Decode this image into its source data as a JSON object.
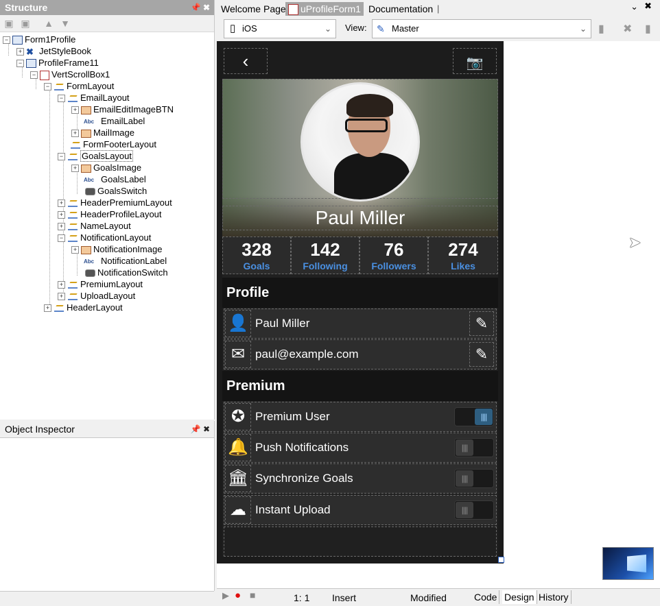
{
  "structure": {
    "title": "Structure",
    "tree": [
      {
        "label": "Form1Profile",
        "icon": "form-icon"
      },
      {
        "label": "JetStyleBook",
        "icon": "stylebook-icon"
      },
      {
        "label": "ProfileFrame11",
        "icon": "frame-icon"
      },
      {
        "label": "VertScrollBox1",
        "icon": "scrollbox-icon"
      },
      {
        "label": "FormLayout",
        "icon": "layout-icon"
      },
      {
        "label": "EmailLayout",
        "icon": "layout-icon"
      },
      {
        "label": "EmailEditImageBTN",
        "icon": "image-icon"
      },
      {
        "label": "EmailLabel",
        "icon": "label-icon"
      },
      {
        "label": "MailImage",
        "icon": "image-icon"
      },
      {
        "label": "FormFooterLayout",
        "icon": "layout-icon"
      },
      {
        "label": "GoalsLayout",
        "icon": "layout-icon"
      },
      {
        "label": "GoalsImage",
        "icon": "image-icon"
      },
      {
        "label": "GoalsLabel",
        "icon": "label-icon"
      },
      {
        "label": "GoalsSwitch",
        "icon": "switch-icon"
      },
      {
        "label": "HeaderPremiumLayout",
        "icon": "layout-icon"
      },
      {
        "label": "HeaderProfileLayout",
        "icon": "layout-icon"
      },
      {
        "label": "NameLayout",
        "icon": "layout-icon"
      },
      {
        "label": "NotificationLayout",
        "icon": "layout-icon"
      },
      {
        "label": "NotificationImage",
        "icon": "image-icon"
      },
      {
        "label": "NotificationLabel",
        "icon": "label-icon"
      },
      {
        "label": "NotificationSwitch",
        "icon": "switch-icon"
      },
      {
        "label": "PremiumLayout",
        "icon": "layout-icon"
      },
      {
        "label": "UploadLayout",
        "icon": "layout-icon"
      },
      {
        "label": "HeaderLayout",
        "icon": "layout-icon"
      }
    ],
    "label_icon_text": "Abc"
  },
  "object_inspector": {
    "title": "Object Inspector"
  },
  "editor_tabs": [
    "Welcome Page",
    "uProfileForm1",
    "Documentation"
  ],
  "designer": {
    "platform": "iOS",
    "view_label": "View:",
    "view_value": "Master"
  },
  "profile": {
    "name": "Paul Miller",
    "stats": [
      {
        "value": "328",
        "label": "Goals"
      },
      {
        "value": "142",
        "label": "Following"
      },
      {
        "value": "76",
        "label": "Followers"
      },
      {
        "value": "274",
        "label": "Likes"
      }
    ],
    "profile_header": "Profile",
    "name_field": "Paul Miller",
    "email_field": "paul@example.com",
    "premium_header": "Premium",
    "settings": [
      {
        "label": "Premium User",
        "on": true
      },
      {
        "label": "Push Notifications",
        "on": false
      },
      {
        "label": "Synchronize Goals",
        "on": false
      },
      {
        "label": "Instant Upload",
        "on": false
      }
    ],
    "switch_glyph": "||||"
  },
  "status_bar": {
    "position": "1:  1",
    "mode": "Insert",
    "state": "Modified",
    "tabs": [
      "Code",
      "Design",
      "History"
    ]
  }
}
